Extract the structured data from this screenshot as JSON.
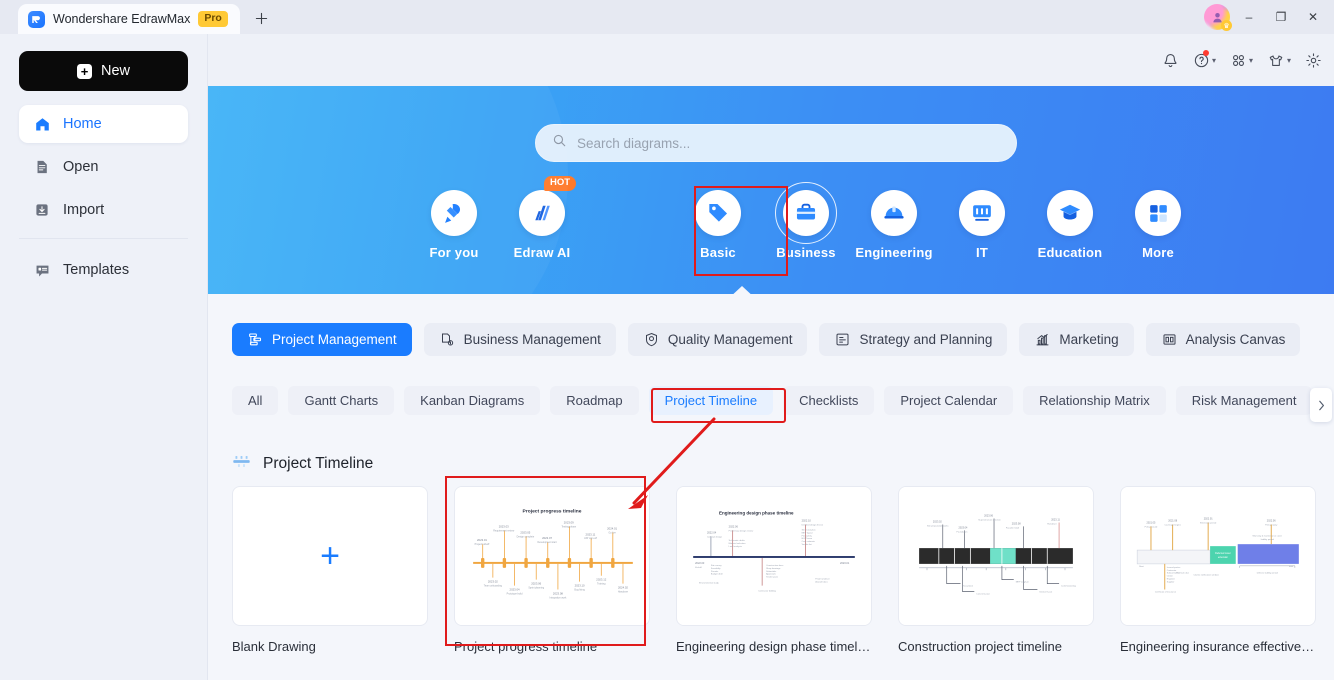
{
  "titlebar": {
    "tab_title": "Wondershare EdrawMax",
    "pro_badge": "Pro",
    "new_tab_icon": "plus-icon",
    "logo_letter": "Ǝ",
    "window_controls": {
      "minimize": "–",
      "restore": "❐",
      "close": "✕"
    }
  },
  "topbar": {
    "icons": [
      {
        "name": "notification-bell-icon",
        "glyph": "bell"
      },
      {
        "name": "help-icon",
        "glyph": "question",
        "caret": "▾",
        "has_dot": true
      },
      {
        "name": "apps-grid-icon",
        "glyph": "grid",
        "caret": "▾"
      },
      {
        "name": "theme-shirt-icon",
        "glyph": "shirt",
        "caret": "▾"
      },
      {
        "name": "settings-gear-icon",
        "glyph": "gear"
      }
    ]
  },
  "sidebar": {
    "new_button": "New",
    "items": [
      {
        "label": "Home",
        "icon": "home-icon",
        "active": true
      },
      {
        "label": "Open",
        "icon": "open-file-icon",
        "active": false
      },
      {
        "label": "Import",
        "icon": "import-icon",
        "active": false
      },
      {
        "label": "Templates",
        "icon": "templates-icon",
        "active": false
      }
    ]
  },
  "hero": {
    "search": {
      "placeholder": "Search diagrams...",
      "value": "",
      "icon": "search-icon"
    },
    "categories": [
      {
        "label": "For you",
        "icon": "for-you-icon",
        "selected": false,
        "badge": ""
      },
      {
        "label": "Edraw AI",
        "icon": "edraw-ai-icon",
        "selected": false,
        "badge": "HOT"
      },
      {
        "label": "Basic",
        "icon": "basic-icon",
        "selected": false,
        "badge": ""
      },
      {
        "label": "Business",
        "icon": "business-briefcase-icon",
        "selected": true,
        "badge": ""
      },
      {
        "label": "Engineering",
        "icon": "engineering-helmet-icon",
        "selected": false,
        "badge": ""
      },
      {
        "label": "IT",
        "icon": "it-monitor-icon",
        "selected": false,
        "badge": ""
      },
      {
        "label": "Education",
        "icon": "education-cap-icon",
        "selected": false,
        "badge": ""
      },
      {
        "label": "More",
        "icon": "more-grid-icon",
        "selected": false,
        "badge": ""
      }
    ]
  },
  "content": {
    "chips": [
      {
        "label": "Project Management",
        "icon": "project-management-icon",
        "active": true
      },
      {
        "label": "Business Management",
        "icon": "business-management-icon",
        "active": false
      },
      {
        "label": "Quality Management",
        "icon": "quality-management-icon",
        "active": false
      },
      {
        "label": "Strategy and Planning",
        "icon": "strategy-planning-icon",
        "active": false
      },
      {
        "label": "Marketing",
        "icon": "marketing-chart-icon",
        "active": false
      },
      {
        "label": "Analysis Canvas",
        "icon": "analysis-canvas-icon",
        "active": false
      }
    ],
    "subchips": [
      {
        "label": "All",
        "selected": false
      },
      {
        "label": "Gantt Charts",
        "selected": false
      },
      {
        "label": "Kanban Diagrams",
        "selected": false
      },
      {
        "label": "Roadmap",
        "selected": false
      },
      {
        "label": "Project Timeline",
        "selected": true
      },
      {
        "label": "Checklists",
        "selected": false
      },
      {
        "label": "Project Calendar",
        "selected": false
      },
      {
        "label": "Relationship Matrix",
        "selected": false
      },
      {
        "label": "Risk Management",
        "selected": false
      }
    ],
    "scroll_next_icon": "chevron-right-icon",
    "section": {
      "title": "Project Timeline",
      "icon": "timeline-icon"
    },
    "cards": [
      {
        "name": "Blank Drawing",
        "thumb": "blank-plus",
        "selected": false
      },
      {
        "name": "Project progress timeline",
        "thumb": "project-progress-timeline",
        "selected": true,
        "thumb_title": "Project progress timeline"
      },
      {
        "name": "Engineering design phase timeline",
        "thumb": "engineering-design-phase-timeline",
        "selected": false,
        "thumb_title": "Engineering design phase timeline"
      },
      {
        "name": "Construction project timeline",
        "thumb": "construction-project-timeline",
        "selected": false,
        "thumb_title": ""
      },
      {
        "name": "Engineering insurance effective t...",
        "thumb": "engineering-insurance-timeline",
        "selected": false,
        "thumb_title": ""
      }
    ]
  },
  "annotations": {
    "highlight_color": "#e01b1b",
    "highlights": [
      "business-category",
      "project-timeline-subchip",
      "project-progress-timeline-card"
    ],
    "arrow": "from-project-timeline-tab-to-card"
  }
}
